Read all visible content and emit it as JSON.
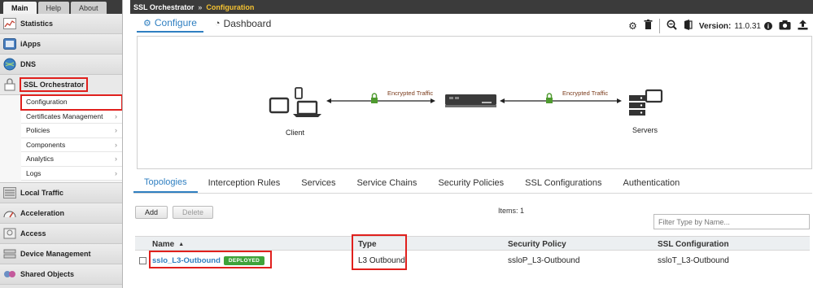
{
  "sidebar": {
    "tabs": [
      "Main",
      "Help",
      "About"
    ],
    "sections": {
      "statistics": "Statistics",
      "iapps": "iApps",
      "dns": "DNS",
      "ssl": "SSL Orchestrator",
      "local": "Local Traffic",
      "accel": "Acceleration",
      "access": "Access",
      "device": "Device Management",
      "shared": "Shared Objects"
    },
    "ssl_items": [
      "Configuration",
      "Certificates Management",
      "Policies",
      "Components",
      "Analytics",
      "Logs"
    ]
  },
  "breadcrumb": {
    "root": "SSL Orchestrator",
    "sep": "»",
    "current": "Configuration"
  },
  "toolbar": {
    "configure": "Configure",
    "dashboard": "Dashboard",
    "version_label": "Version:",
    "version": "11.0.31"
  },
  "diagram": {
    "client": "Client",
    "servers": "Servers",
    "encrypted": "Encrypted Traffic"
  },
  "tabs": [
    "Topologies",
    "Interception Rules",
    "Services",
    "Service Chains",
    "Security Policies",
    "SSL Configurations",
    "Authentication"
  ],
  "actions": {
    "add": "Add",
    "delete": "Delete",
    "items": "Items: 1",
    "filter_placeholder": "Filter Type by Name..."
  },
  "table": {
    "headers": {
      "name": "Name",
      "type": "Type",
      "policy": "Security Policy",
      "ssl": "SSL Configuration"
    },
    "row": {
      "name": "sslo_L3-Outbound",
      "status": "DEPLOYED",
      "type": "L3 Outbound",
      "policy": "ssloP_L3-Outbound",
      "ssl": "ssloT_L3-Outbound"
    }
  },
  "colors": {
    "accent": "#2f7fc1",
    "highlight": "#e0201d",
    "deployed": "#3fa33a",
    "breadcrumb_current": "#f5c231"
  }
}
